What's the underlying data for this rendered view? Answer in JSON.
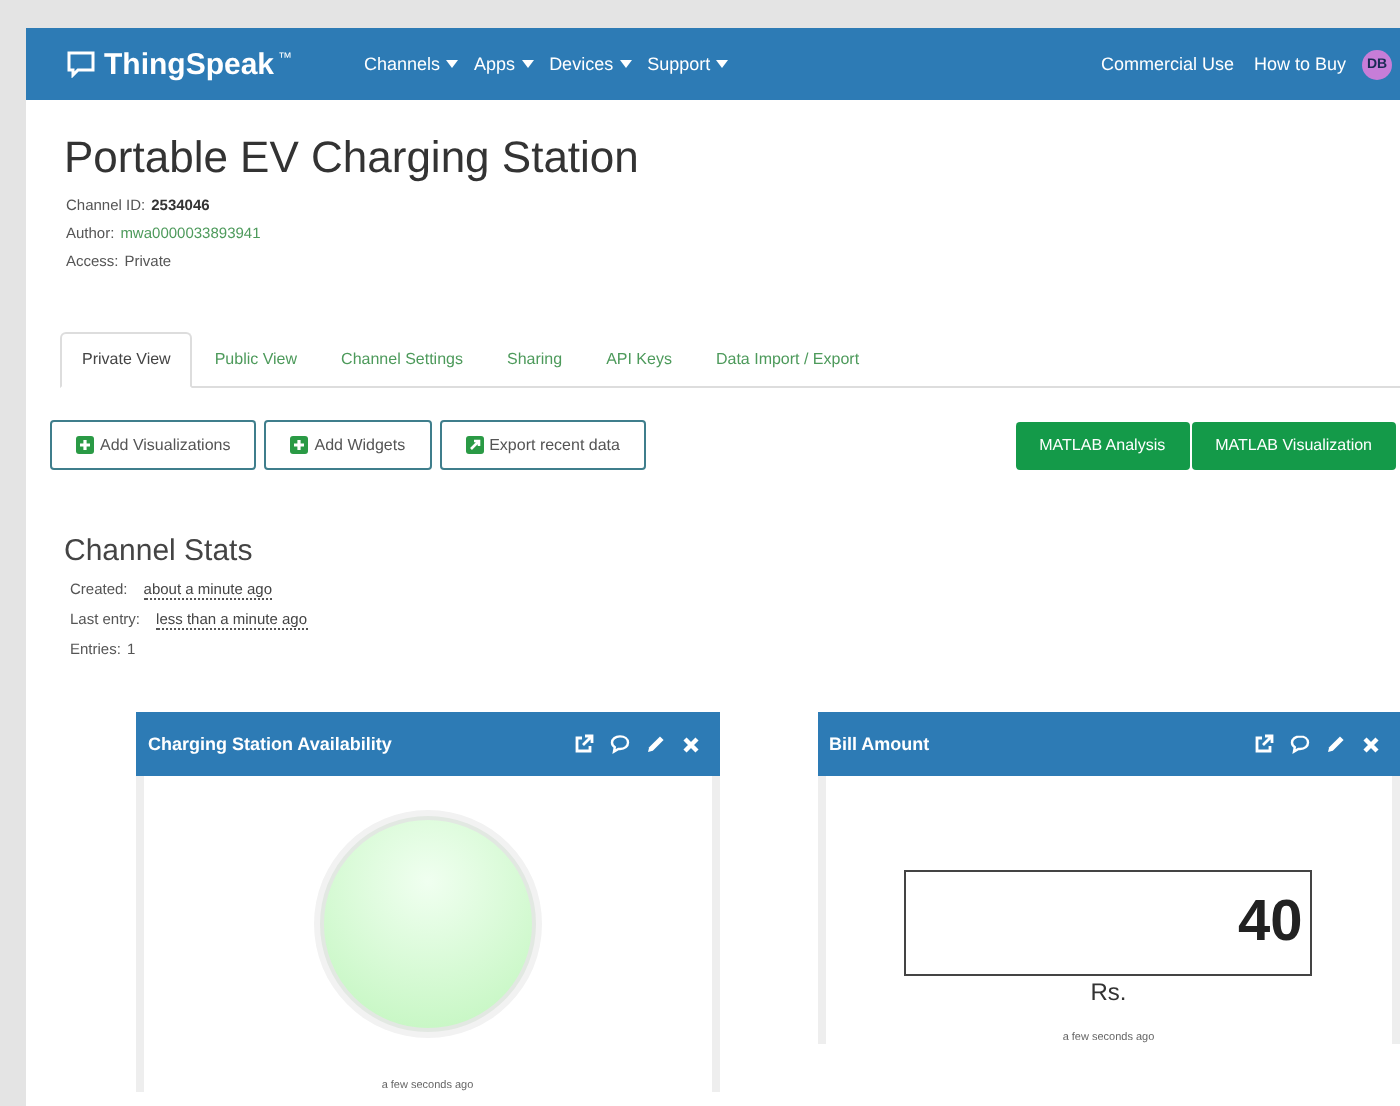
{
  "navbar": {
    "brand": "ThingSpeak",
    "trademark": "™",
    "menus": [
      {
        "label": "Channels"
      },
      {
        "label": "Apps"
      },
      {
        "label": "Devices"
      },
      {
        "label": "Support"
      }
    ],
    "links": [
      "Commercial Use",
      "How to Buy"
    ],
    "avatar": "DB"
  },
  "channel": {
    "title": "Portable EV Charging Station",
    "meta": [
      {
        "label": "Channel ID:",
        "value": "2534046",
        "kind": "bold"
      },
      {
        "label": "Author:",
        "value": "mwa0000033893941",
        "kind": "link"
      },
      {
        "label": "Access:",
        "value": "Private",
        "kind": "plain"
      }
    ]
  },
  "tabs": [
    {
      "label": "Private View",
      "selected": true
    },
    {
      "label": "Public View",
      "selected": false
    },
    {
      "label": "Channel Settings",
      "selected": false
    },
    {
      "label": "Sharing",
      "selected": false
    },
    {
      "label": "API Keys",
      "selected": false
    },
    {
      "label": "Data Import / Export",
      "selected": false
    }
  ],
  "actions": [
    {
      "label": "Add Visualizations",
      "kind": "add"
    },
    {
      "label": "Add Widgets",
      "kind": "add"
    },
    {
      "label": "Export recent data",
      "kind": "export"
    }
  ],
  "matlab_buttons": [
    "MATLAB Analysis",
    "MATLAB Visualization"
  ],
  "stats": {
    "title": "Channel Stats",
    "rows": [
      {
        "label": "Created:",
        "value": "about a minute ago",
        "kind": "time"
      },
      {
        "label": "Last entry:",
        "value": "less than a minute ago",
        "kind": "time"
      },
      {
        "label": "Entries:",
        "value": "1",
        "kind": "count"
      }
    ]
  },
  "widgets": [
    {
      "kind": "lamp",
      "title": "Charging Station Availability",
      "lit": true,
      "updated": "a few seconds ago"
    },
    {
      "kind": "numeric",
      "title": "Bill Amount",
      "value": "40",
      "unit": "Rs.",
      "updated": "a few seconds ago"
    }
  ]
}
